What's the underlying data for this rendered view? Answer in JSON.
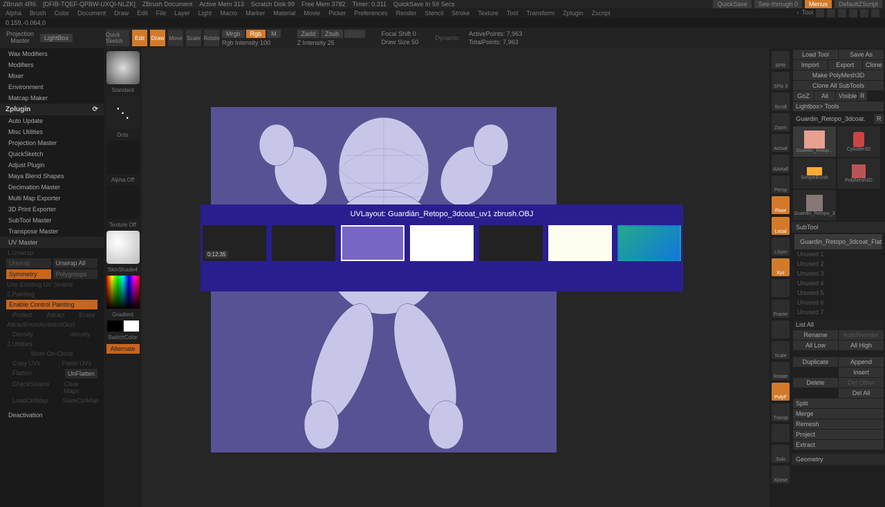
{
  "titlebar": {
    "app": "ZBrush 4R6",
    "doc_id": "[DFIB-TQEF-QPBW-UXQI-NLZK]",
    "doc": "ZBrush Document",
    "mem": "Active Mem 313",
    "scratch": "Scratch Disk 99",
    "freemem": "Free Mem 3782",
    "timer": "Timer: 0.311",
    "quicksave_timer": "QuickSave In 59 Secs",
    "quicksave": "QuickSave",
    "seethrough": "See-through  0",
    "menus": "Menus",
    "script": "DefaultZScript"
  },
  "menubar": {
    "items": [
      "Alpha",
      "Brush",
      "Color",
      "Document",
      "Draw",
      "Edit",
      "File",
      "Layer",
      "Light",
      "Macro",
      "Marker",
      "Material",
      "Movie",
      "Picker",
      "Preferences",
      "Render",
      "Stencil",
      "Stroke",
      "Texture",
      "Tool",
      "Transform",
      "Zplugin",
      "Zscript"
    ]
  },
  "coords": "0.159,-0.064,0",
  "toolbar": {
    "projection": "Projection\nMaster",
    "lightbox": "LightBox",
    "quicksketch": "Quick\nSketch",
    "edit": "Edit",
    "draw": "Draw",
    "move": "Move",
    "scale": "Scale",
    "rotate": "Rotate",
    "mrgb": "Mrgb",
    "rgb": "Rgb",
    "m": "M",
    "rgb_intensity": "Rgb Intensity 100",
    "zadd": "Zadd",
    "zsub": "Zsub",
    "zcut": "Zcut",
    "z_intensity": "Z Intensity 25",
    "focal": "Focal Shift 0",
    "draw_size": "Draw Size 50",
    "dynamic": "Dynamic",
    "active_pts": "ActivePoints: 7,963",
    "total_pts": "TotalPoints: 7,963"
  },
  "leftpanel": {
    "items_top": [
      "Wax Modifiers",
      "Modifiers",
      "Mixer",
      "Environment",
      "Matcap Maker"
    ],
    "zplugin": "Zplugin",
    "items_plugin": [
      "Auto Update",
      "Misc Utilities",
      "Projection Master",
      "QuickSketch",
      "Adjust Plugin",
      "Maya Blend Shapes",
      "Decimation Master",
      "Multi Map Exporter",
      "3D Print Exporter",
      "SubTool Master",
      "Transpose Master",
      "UV Master"
    ],
    "unwrap_title": "1.Unwrap",
    "unwrap": "Unwrap",
    "unwrap_all": "Unwrap All",
    "symmetry": "Symmetry",
    "polygroups": "Polygroups",
    "use_existing": "Use Existing UV Seams",
    "painting": "2.Painting",
    "enable_ctrl": "Enable Control Painting",
    "protect": "Protect",
    "attract": "Attract",
    "erase": "Erase",
    "ambient": "AttractFromAmbientOccl",
    "density": "Density",
    "density2": "density.",
    "utilities": "3.Utilities",
    "work_clone": "Work On Clone",
    "copy_uvs": "Copy UVs",
    "paste_uvs": "Paste UVs",
    "flatten": "Flatten",
    "unflatten": "UnFlatten",
    "checkseams": "CheckSeams",
    "clearmaps": "Clear Maps",
    "loadctrl": "LoadCtrlMap",
    "savectrl": "SaveCtrlMap",
    "deactivation": "Deactivation"
  },
  "brushcol": {
    "standard": "Standard",
    "dots": "Dots",
    "alpha": "Alpha Off",
    "texture": "Texture Off",
    "skinshade": "SkinShade4",
    "gradient": "Gradient",
    "switch": "SwitchColor",
    "alternate": "Alternate"
  },
  "rightstrip": {
    "items": [
      "BPR",
      "SPix 3",
      "Scroll",
      "Zoom",
      "Actual",
      "AAHalf",
      "Persp",
      "Floor",
      "Local",
      "LSym",
      "Xyz",
      "",
      "Frame",
      "",
      "Scale",
      "Rotate",
      "PolyF",
      "Transp",
      "",
      "Solo",
      "Xpose"
    ]
  },
  "rightpanel": {
    "tool": "Tool",
    "load": "Load Tool",
    "saveas": "Save As",
    "import": "Import",
    "export": "Export",
    "clone": "Clone",
    "makepoly": "Make PolyMesh3D",
    "cloneall": "Clone All SubTools",
    "goz": "GoZ",
    "all": "All",
    "visible": "Visible",
    "r": "R",
    "lightbox_tools": "Lightbox> Tools",
    "current": "Guardin_Retopo_3dcoat.",
    "r2": "R",
    "thumbs": [
      {
        "name": "Guardin_Retop...",
        "color": "#e88"
      },
      {
        "name": "Cylinder3D",
        "color": "#c44"
      },
      {
        "name": "SimpleBrush",
        "color": "#fa3"
      },
      {
        "name": "PolyMesh3D",
        "color": "#b55"
      },
      {
        "name": "Guardin_Retopo_3",
        "color": "#877"
      }
    ],
    "subtool": "SubTool",
    "sub_item": "Guardin_Retopo_3dcoat_Flat",
    "sublist": [
      "Unused 1",
      "Unused 2",
      "Unused 3",
      "Unused 4",
      "Unused 5",
      "Unused 6",
      "Unused 7"
    ],
    "listall": "List All",
    "rename": "Rename",
    "autoreorder": "AutoReorder",
    "alllow": "All Low",
    "allhigh": "All High",
    "duplicate": "Duplicate",
    "append": "Append",
    "insert": "Insert",
    "delete": "Delete",
    "delother": "Del Other",
    "delall": "Del All",
    "split": "Split",
    "merge": "Merge",
    "remesh": "Remesh",
    "project": "Project",
    "extract": "Extract",
    "geometry": "Geometry"
  },
  "alttab": {
    "title": "UVLayout: Guardián_Retopo_3dcoat_uv1 zbrush.OBJ",
    "thumb_timer": "0:12:35"
  }
}
